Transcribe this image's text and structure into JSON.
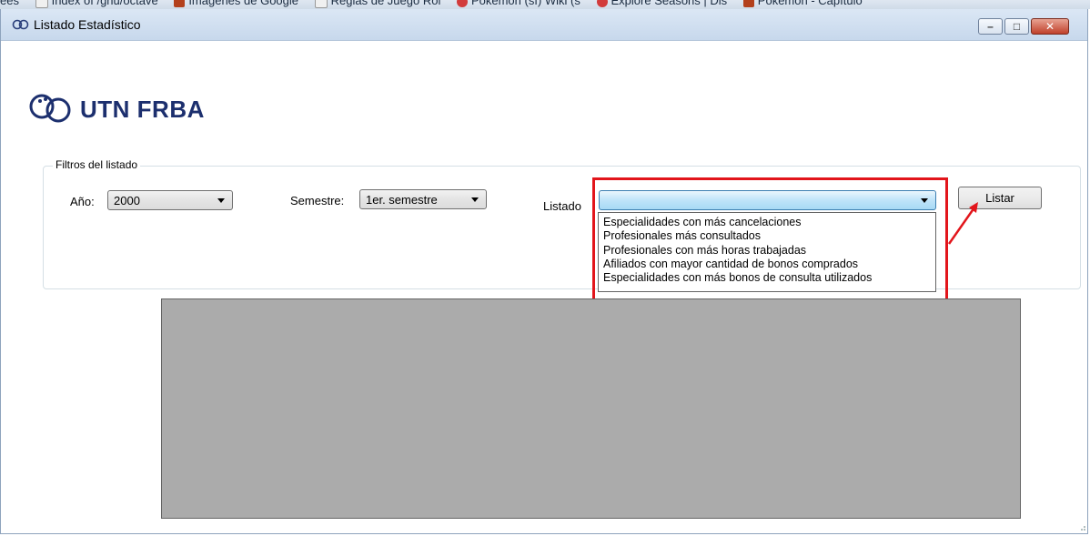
{
  "bookmarks": [
    {
      "label": "ees"
    },
    {
      "label": "Index of /gnu/octave"
    },
    {
      "label": "Imágenes de Google"
    },
    {
      "label": "Reglas de Juego Rol"
    },
    {
      "label": "Pokemon (sf) Wiki (s"
    },
    {
      "label": "Explore Seasons | Dis"
    },
    {
      "label": "Pokémon - Capítulo"
    }
  ],
  "window": {
    "title": "Listado Estadístico",
    "controls": {
      "minimize": "–",
      "maximize": "□",
      "close": "✕"
    }
  },
  "logo": {
    "text": "UTN FRBA",
    "icon": "utn-logo-icon"
  },
  "filters": {
    "group_label": "Filtros del listado",
    "year_label": "Año:",
    "year_value": "2000",
    "semester_label": "Semestre:",
    "semester_value": "1er. semestre",
    "listado_label": "Listado",
    "listado_value": "",
    "listado_options": [
      "Especialidades con más cancelaciones",
      "Profesionales más consultados",
      "Profesionales con más horas trabajadas",
      "Afiliados con mayor cantidad de bonos comprados",
      "Especialidades con más bonos de consulta utilizados"
    ],
    "list_button": "Listar"
  },
  "colors": {
    "annotation": "#e2151b",
    "grid_background": "#ababab",
    "logo": "#1c2f6e"
  }
}
